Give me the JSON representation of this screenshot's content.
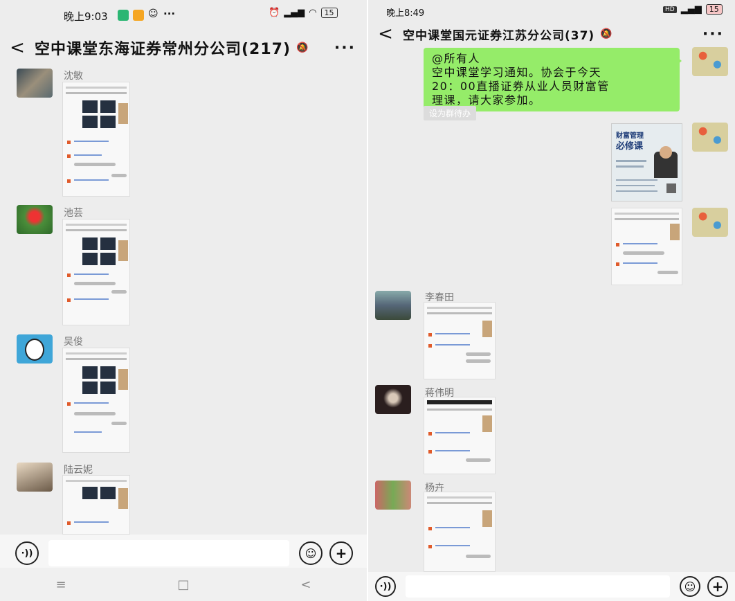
{
  "left": {
    "status": {
      "time": "晚上9:03",
      "dots": "···",
      "battery": "15"
    },
    "title": "空中课堂东海证券常州分公司(217)",
    "more": "···",
    "messages": [
      {
        "sender": "沈敏"
      },
      {
        "sender": "池芸"
      },
      {
        "sender": "吴俊"
      },
      {
        "sender": "陆云妮"
      }
    ],
    "nav": {
      "menu": "≡",
      "home": "□",
      "back": "<"
    }
  },
  "right": {
    "status": {
      "time": "晚上8:49",
      "battery": "15"
    },
    "title": "空中课堂国元证券江苏分公司(37)",
    "more": "···",
    "notice": {
      "line1": "@所有人",
      "line2": "空中课堂学习通知。协会于今天",
      "line3": "20：00直播证券从业人员财富管",
      "line4": "理课，请大家参加。"
    },
    "todo": "设为群待办",
    "poster": {
      "line1": "财富管理",
      "line2": "必修课"
    },
    "messages": [
      {
        "sender": "李春田"
      },
      {
        "sender": "蒋伟明"
      },
      {
        "sender": "杨卉"
      }
    ]
  },
  "colors": {
    "bubble": "#95ec69",
    "background": "#ededed"
  }
}
